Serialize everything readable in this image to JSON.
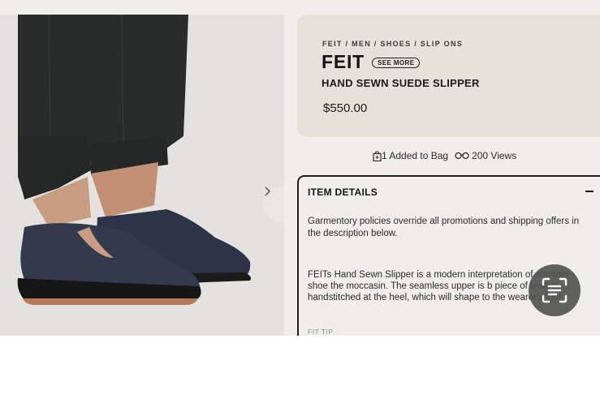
{
  "product": {
    "breadcrumb": "FEIT / MEN / SHOES / SLIP ONS",
    "brand": "FEIT",
    "see_more": "SEE MORE",
    "name": "HAND SEWN SUEDE SLIPPER",
    "price": "$550.00"
  },
  "stats": {
    "added": "1 Added to Bag",
    "views": "200 Views"
  },
  "details": {
    "header": "ITEM DETAILS",
    "policy": "Garmentory policies override all promotions and shipping offers in the description below.",
    "description": "FEITs Hand Sewn Slipper is a modern interpretation of summer shoe the moccasin. The seamless upper is b piece of leather, handstitched at the heel, which will shape to the wearer's foot.",
    "fit_tip": "FIT TIP"
  },
  "icons": {
    "bag": "shopping-bag-icon",
    "views": "glasses-icon",
    "next": "chevron-right-icon",
    "collapse": "minus-icon",
    "lens": "scan-text-icon"
  },
  "colors": {
    "background": "#efeeeb",
    "card": "#e5e2dc",
    "text": "#1a1a1a"
  }
}
